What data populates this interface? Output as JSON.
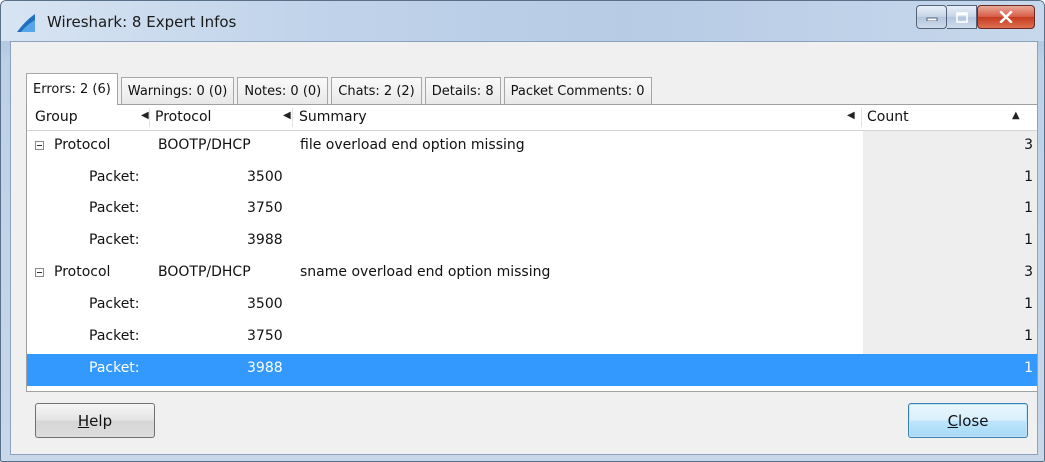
{
  "window": {
    "title": "Wireshark: 8 Expert Infos"
  },
  "icons": {
    "app": "wireshark-fin-icon",
    "minimize": "minimize-icon",
    "maximize": "maximize-icon",
    "close": "close-x-icon"
  },
  "tabs": [
    {
      "label": "Errors: 2 (6)",
      "active": true
    },
    {
      "label": "Warnings: 0 (0)",
      "active": false
    },
    {
      "label": "Notes: 0 (0)",
      "active": false
    },
    {
      "label": "Chats: 2 (2)",
      "active": false
    },
    {
      "label": "Details: 8",
      "active": false
    },
    {
      "label": "Packet Comments: 0",
      "active": false
    }
  ],
  "columns": {
    "group": "Group",
    "protocol": "Protocol",
    "summary": "Summary",
    "count": "Count"
  },
  "rows": [
    {
      "group": "Protocol",
      "protocol": "BOOTP/DHCP",
      "summary": "file overload end option missing",
      "count": "3"
    },
    {
      "group": "Packet:",
      "protocol": "3500",
      "summary": "",
      "count": "1"
    },
    {
      "group": "Packet:",
      "protocol": "3750",
      "summary": "",
      "count": "1"
    },
    {
      "group": "Packet:",
      "protocol": "3988",
      "summary": "",
      "count": "1"
    },
    {
      "group": "Protocol",
      "protocol": "BOOTP/DHCP",
      "summary": "sname overload end option missing",
      "count": "3"
    },
    {
      "group": "Packet:",
      "protocol": "3500",
      "summary": "",
      "count": "1"
    },
    {
      "group": "Packet:",
      "protocol": "3750",
      "summary": "",
      "count": "1"
    },
    {
      "group": "Packet:",
      "protocol": "3988",
      "summary": "",
      "count": "1"
    }
  ],
  "selected_row": 7,
  "buttons": {
    "help_label": "Help",
    "help_accel": "H",
    "help_rest": "elp",
    "close_label": "Close",
    "close_accel": "C",
    "close_rest": "lose"
  },
  "colors": {
    "selection": "#3399ff",
    "count_column_bg": "#eeeeee"
  }
}
